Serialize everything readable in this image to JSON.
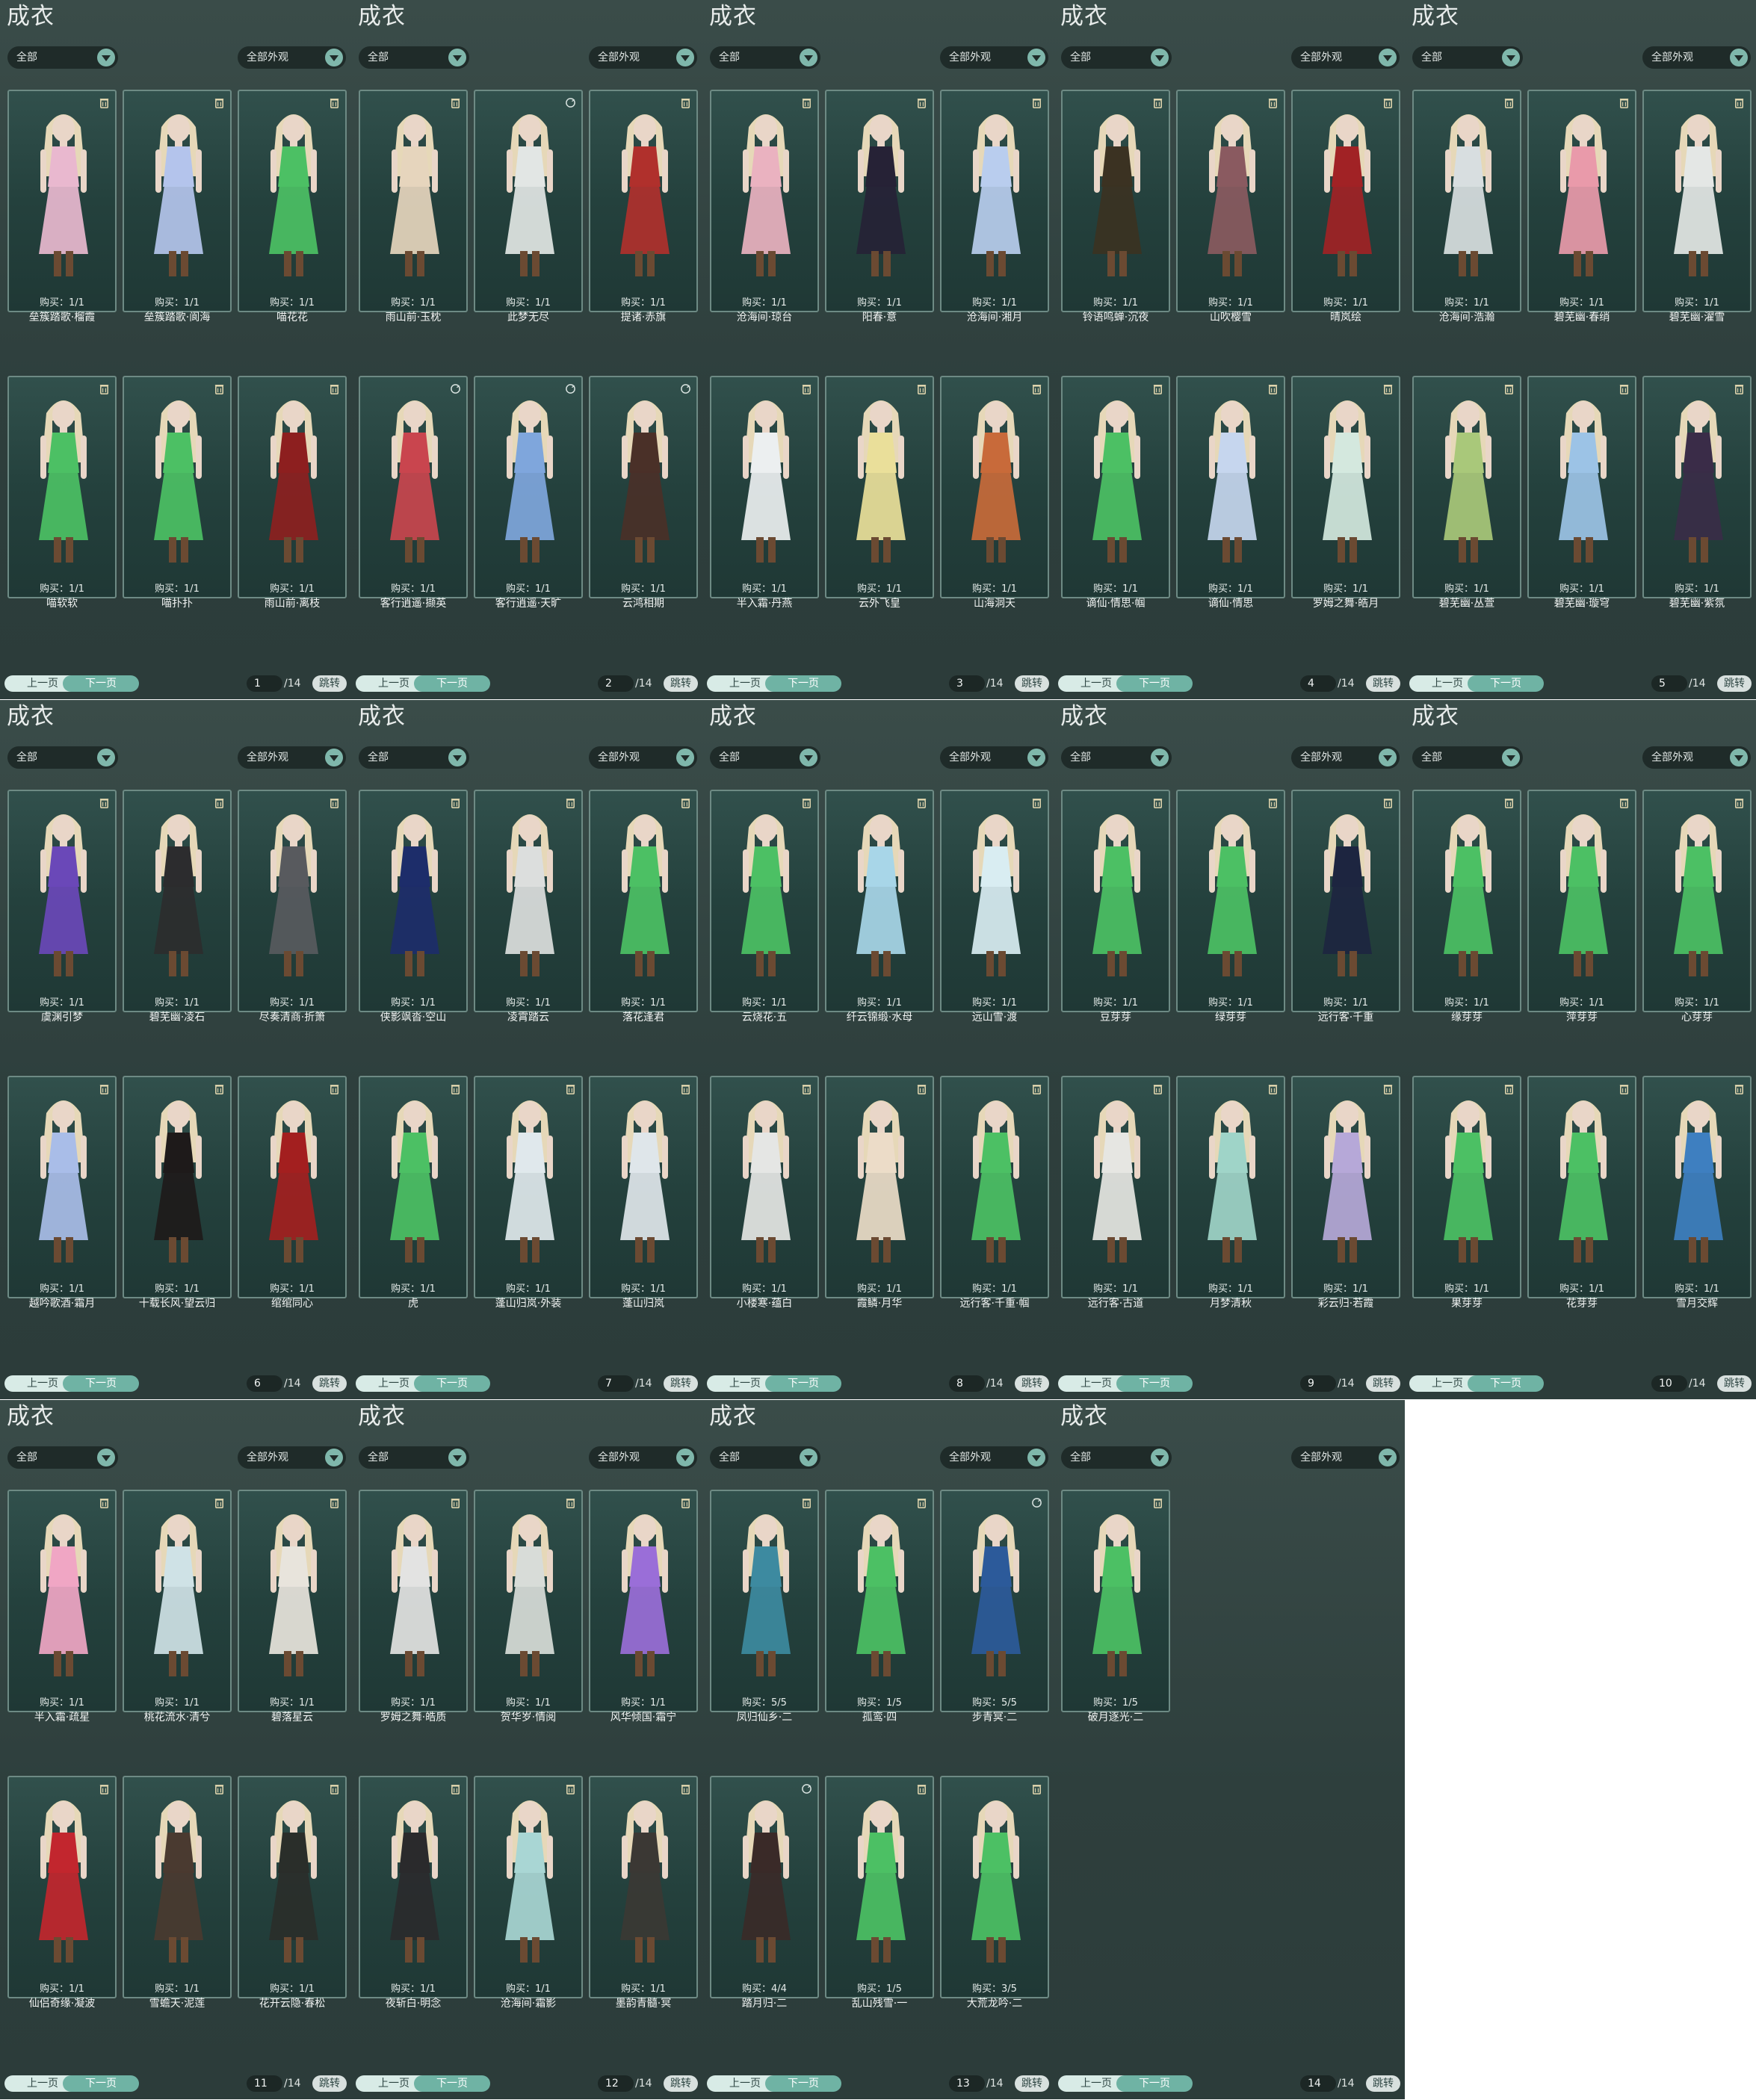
{
  "panel_title": "成衣",
  "filter_1": "全部",
  "filter_2": "全部外观",
  "prev_label": "上一页",
  "next_label": "下一页",
  "total_pages": "/14",
  "jump_label": "跳转",
  "colors": {
    "panel_bg": "#33453f",
    "card_bg": "#24413d",
    "card_border": "#6d8a84",
    "accent": "#6fb3a4",
    "skin": "#e9d6c8",
    "hair": "#e6d8b8"
  },
  "pages": [
    {
      "page": "1",
      "items": [
        {
          "name": "垒簇踏歌·榴霞",
          "purchase": "购买：1/1",
          "outfit": "#e9b8cf",
          "lock": "trash"
        },
        {
          "name": "垒簇踏歌·阆海",
          "purchase": "购买：1/1",
          "outfit": "#b4c4ec",
          "lock": "trash"
        },
        {
          "name": "喵花花",
          "purchase": "购买：1/1",
          "outfit": "#4cc064",
          "lock": "trash"
        },
        {
          "name": "喵软软",
          "purchase": "购买：1/1",
          "outfit": "#4cc064",
          "lock": "trash"
        },
        {
          "name": "喵扑扑",
          "purchase": "购买：1/1",
          "outfit": "#4cc064",
          "lock": "trash"
        },
        {
          "name": "雨山前·离枝",
          "purchase": "购买：1/1",
          "outfit": "#8d1f1f",
          "lock": "trash"
        }
      ]
    },
    {
      "page": "2",
      "items": [
        {
          "name": "雨山前·玉枕",
          "purchase": "购买：1/1",
          "outfit": "#e6d5bd",
          "lock": "trash"
        },
        {
          "name": "此梦无尽",
          "purchase": "购买：1/1",
          "outfit": "#e2e6e4",
          "lock": "cycle"
        },
        {
          "name": "提诸·赤旗",
          "purchase": "购买：1/1",
          "outfit": "#b0302c",
          "lock": "trash"
        },
        {
          "name": "客行逍遥·撷英",
          "purchase": "购买：1/1",
          "outfit": "#c9454e",
          "lock": "cycle"
        },
        {
          "name": "客行逍遥·天旷",
          "purchase": "购买：1/1",
          "outfit": "#7fa6dc",
          "lock": "cycle"
        },
        {
          "name": "云鸿相期",
          "purchase": "购买：1/1",
          "outfit": "#4a3028",
          "lock": "cycle"
        }
      ]
    },
    {
      "page": "3",
      "items": [
        {
          "name": "沧海间·琼台",
          "purchase": "购买：1/1",
          "outfit": "#eab2c0",
          "lock": "trash"
        },
        {
          "name": "阳春·意",
          "purchase": "购买：1/1",
          "outfit": "#262236",
          "lock": "trash"
        },
        {
          "name": "沧海间·湘月",
          "purchase": "购买：1/1",
          "outfit": "#b9cdee",
          "lock": "trash"
        },
        {
          "name": "半入霜·丹燕",
          "purchase": "购买：1/1",
          "outfit": "#eceff0",
          "lock": "trash"
        },
        {
          "name": "云外飞皇",
          "purchase": "购买：1/1",
          "outfit": "#eadf9a",
          "lock": "trash"
        },
        {
          "name": "山海洞天",
          "purchase": "购买：1/1",
          "outfit": "#c86a3a",
          "lock": "trash"
        }
      ]
    },
    {
      "page": "4",
      "items": [
        {
          "name": "铃语鸣蝉·沉夜",
          "purchase": "购买：1/1",
          "outfit": "#3b3222",
          "lock": "trash"
        },
        {
          "name": "山吹樱雪",
          "purchase": "购买：1/1",
          "outfit": "#8a5a60",
          "lock": "trash"
        },
        {
          "name": "晴岚绘",
          "purchase": "购买：1/1",
          "outfit": "#a12225",
          "lock": "trash"
        },
        {
          "name": "谪仙·情思·帼",
          "purchase": "购买：1/1",
          "outfit": "#4cc064",
          "lock": "trash"
        },
        {
          "name": "谪仙·情思",
          "purchase": "购买：1/1",
          "outfit": "#c6d6ee",
          "lock": "trash"
        },
        {
          "name": "罗姆之舞·皓月",
          "purchase": "购买：1/1",
          "outfit": "#d4e8de",
          "lock": "trash"
        }
      ]
    },
    {
      "page": "5",
      "items": [
        {
          "name": "沧海间·浩瀚",
          "purchase": "购买：1/1",
          "outfit": "#d8dee0",
          "lock": "trash"
        },
        {
          "name": "碧芜幽·春绡",
          "purchase": "购买：1/1",
          "outfit": "#e99aaa",
          "lock": "trash"
        },
        {
          "name": "碧芜幽·濯雪",
          "purchase": "购买：1/1",
          "outfit": "#e4e7e5",
          "lock": "trash"
        },
        {
          "name": "碧芜幽·丛萱",
          "purchase": "购买：1/1",
          "outfit": "#a9c87a",
          "lock": "trash"
        },
        {
          "name": "碧芜幽·璇穹",
          "purchase": "购买：1/1",
          "outfit": "#9cc3e6",
          "lock": "trash"
        },
        {
          "name": "碧芜幽·紫氛",
          "purchase": "购买：1/1",
          "outfit": "#3a2c48",
          "lock": "trash"
        }
      ]
    },
    {
      "page": "6",
      "items": [
        {
          "name": "虞渊引梦",
          "purchase": "购买：1/1",
          "outfit": "#6a48b8",
          "lock": "trash"
        },
        {
          "name": "碧芜幽·凌石",
          "purchase": "购买：1/1",
          "outfit": "#2c2c2e",
          "lock": "trash"
        },
        {
          "name": "尽奏清商·折箫",
          "purchase": "购买：1/1",
          "outfit": "#585a5e",
          "lock": "trash"
        },
        {
          "name": "越吟歌酒·霜月",
          "purchase": "购买：1/1",
          "outfit": "#a9bde8",
          "lock": "trash"
        },
        {
          "name": "十载长风·望云归",
          "purchase": "购买：1/1",
          "outfit": "#1e1a1a",
          "lock": "trash"
        },
        {
          "name": "绾绾同心",
          "purchase": "购买：1/1",
          "outfit": "#a31f1f",
          "lock": "trash"
        }
      ]
    },
    {
      "page": "7",
      "items": [
        {
          "name": "侠影飒沓·空山",
          "purchase": "购买：1/1",
          "outfit": "#1d2d6a",
          "lock": "trash"
        },
        {
          "name": "凌霄踏云",
          "purchase": "购买：1/1",
          "outfit": "#dcdedd",
          "lock": "trash"
        },
        {
          "name": "落花逢君",
          "purchase": "购买：1/1",
          "outfit": "#4cc064",
          "lock": "trash"
        },
        {
          "name": "虎",
          "purchase": "购买：1/1",
          "outfit": "#4cc064",
          "lock": "trash"
        },
        {
          "name": "蓬山归岚·外装",
          "purchase": "购买：1/1",
          "outfit": "#e0e8ec",
          "lock": "trash"
        },
        {
          "name": "蓬山归岚",
          "purchase": "购买：1/1",
          "outfit": "#dfe6ea",
          "lock": "trash"
        }
      ]
    },
    {
      "page": "8",
      "items": [
        {
          "name": "云烧花·五",
          "purchase": "购买：1/1",
          "outfit": "#4cc064",
          "lock": "trash"
        },
        {
          "name": "纤云锦缎·水母",
          "purchase": "购买：1/1",
          "outfit": "#a8d6e8",
          "lock": "trash"
        },
        {
          "name": "远山雪·渡",
          "purchase": "购买：1/1",
          "outfit": "#d9edf2",
          "lock": "trash"
        },
        {
          "name": "小楼寒·蕴白",
          "purchase": "购买：1/1",
          "outfit": "#e5e6e4",
          "lock": "trash"
        },
        {
          "name": "霞鳞·月华",
          "purchase": "购买：1/1",
          "outfit": "#ecdcc8",
          "lock": "trash"
        },
        {
          "name": "远行客·千重·帼",
          "purchase": "购买：1/1",
          "outfit": "#4cc064",
          "lock": "trash"
        }
      ]
    },
    {
      "page": "9",
      "items": [
        {
          "name": "豆芽芽",
          "purchase": "购买：1/1",
          "outfit": "#4cc064",
          "lock": "trash"
        },
        {
          "name": "绿芽芽",
          "purchase": "购买：1/1",
          "outfit": "#4cc064",
          "lock": "trash"
        },
        {
          "name": "远行客·千重",
          "purchase": "购买：1/1",
          "outfit": "#1d2540",
          "lock": "trash"
        },
        {
          "name": "远行客·古道",
          "purchase": "购买：1/1",
          "outfit": "#e6e6e2",
          "lock": "trash"
        },
        {
          "name": "月梦清秋",
          "purchase": "购买：1/1",
          "outfit": "#9fd4c8",
          "lock": "trash"
        },
        {
          "name": "彩云归·若霞",
          "purchase": "购买：1/1",
          "outfit": "#b6a8d8",
          "lock": "trash"
        }
      ]
    },
    {
      "page": "10",
      "items": [
        {
          "name": "缘芽芽",
          "purchase": "购买：1/1",
          "outfit": "#4cc064",
          "lock": "trash"
        },
        {
          "name": "萍芽芽",
          "purchase": "购买：1/1",
          "outfit": "#4cc064",
          "lock": "trash"
        },
        {
          "name": "心芽芽",
          "purchase": "购买：1/1",
          "outfit": "#4cc064",
          "lock": "trash"
        },
        {
          "name": "果芽芽",
          "purchase": "购买：1/1",
          "outfit": "#4cc064",
          "lock": "trash"
        },
        {
          "name": "花芽芽",
          "purchase": "购买：1/1",
          "outfit": "#4cc064",
          "lock": "trash"
        },
        {
          "name": "雪月交辉",
          "purchase": "购买：1/1",
          "outfit": "#3e7fc0",
          "lock": "trash"
        }
      ]
    },
    {
      "page": "11",
      "items": [
        {
          "name": "半入霜·疏星",
          "purchase": "购买：1/1",
          "outfit": "#f0a6c4",
          "lock": "trash"
        },
        {
          "name": "桃花流水·清兮",
          "purchase": "购买：1/1",
          "outfit": "#cfe2e6",
          "lock": "trash"
        },
        {
          "name": "碧落星云",
          "purchase": "购买：1/1",
          "outfit": "#e8e4dc",
          "lock": "trash"
        },
        {
          "name": "仙侣奇缘·凝波",
          "purchase": "购买：1/1",
          "outfit": "#c2262e",
          "lock": "trash"
        },
        {
          "name": "雪蟾天·泥莲",
          "purchase": "购买：1/1",
          "outfit": "#4a3a30",
          "lock": "trash"
        },
        {
          "name": "花开云隐·春松",
          "purchase": "购买：1/1",
          "outfit": "#2a2e2a",
          "lock": "trash"
        }
      ]
    },
    {
      "page": "12",
      "items": [
        {
          "name": "罗姆之舞·皓质",
          "purchase": "购买：1/1",
          "outfit": "#e3e3e2",
          "lock": "trash"
        },
        {
          "name": "贺华岁·情阅",
          "purchase": "购买：1/1",
          "outfit": "#d8dcd8",
          "lock": "trash"
        },
        {
          "name": "风华倾国·霜宁",
          "purchase": "购买：1/1",
          "outfit": "#9a6ed8",
          "lock": "trash"
        },
        {
          "name": "夜斩白·明念",
          "purchase": "购买：1/1",
          "outfit": "#2a2a2c",
          "lock": "trash"
        },
        {
          "name": "沧海间·霜影",
          "purchase": "购买：1/1",
          "outfit": "#a9d6d4",
          "lock": "trash"
        },
        {
          "name": "墨韵青髓·冥",
          "purchase": "购买：1/1",
          "outfit": "#3b3834",
          "lock": "trash"
        }
      ]
    },
    {
      "page": "13",
      "items": [
        {
          "name": "凤归仙乡·二",
          "purchase": "购买：5/5",
          "outfit": "#3d8aa0",
          "lock": "trash"
        },
        {
          "name": "孤鸾·四",
          "purchase": "购买：1/5",
          "outfit": "#4cc064",
          "lock": "trash"
        },
        {
          "name": "步青冥·二",
          "purchase": "购买：5/5",
          "outfit": "#2c5a9a",
          "lock": "cycle"
        },
        {
          "name": "踏月归·二",
          "purchase": "购买：4/4",
          "outfit": "#3a2a28",
          "lock": "cycle"
        },
        {
          "name": "乱山残雪·一",
          "purchase": "购买：1/5",
          "outfit": "#4cc064",
          "lock": "trash"
        },
        {
          "name": "大荒龙吟·二",
          "purchase": "购买：3/5",
          "outfit": "#4cc064",
          "lock": "trash"
        }
      ]
    },
    {
      "page": "14",
      "items": [
        {
          "name": "破月逐光·二",
          "purchase": "购买：1/5",
          "outfit": "#4cc064",
          "lock": "trash"
        }
      ]
    }
  ]
}
